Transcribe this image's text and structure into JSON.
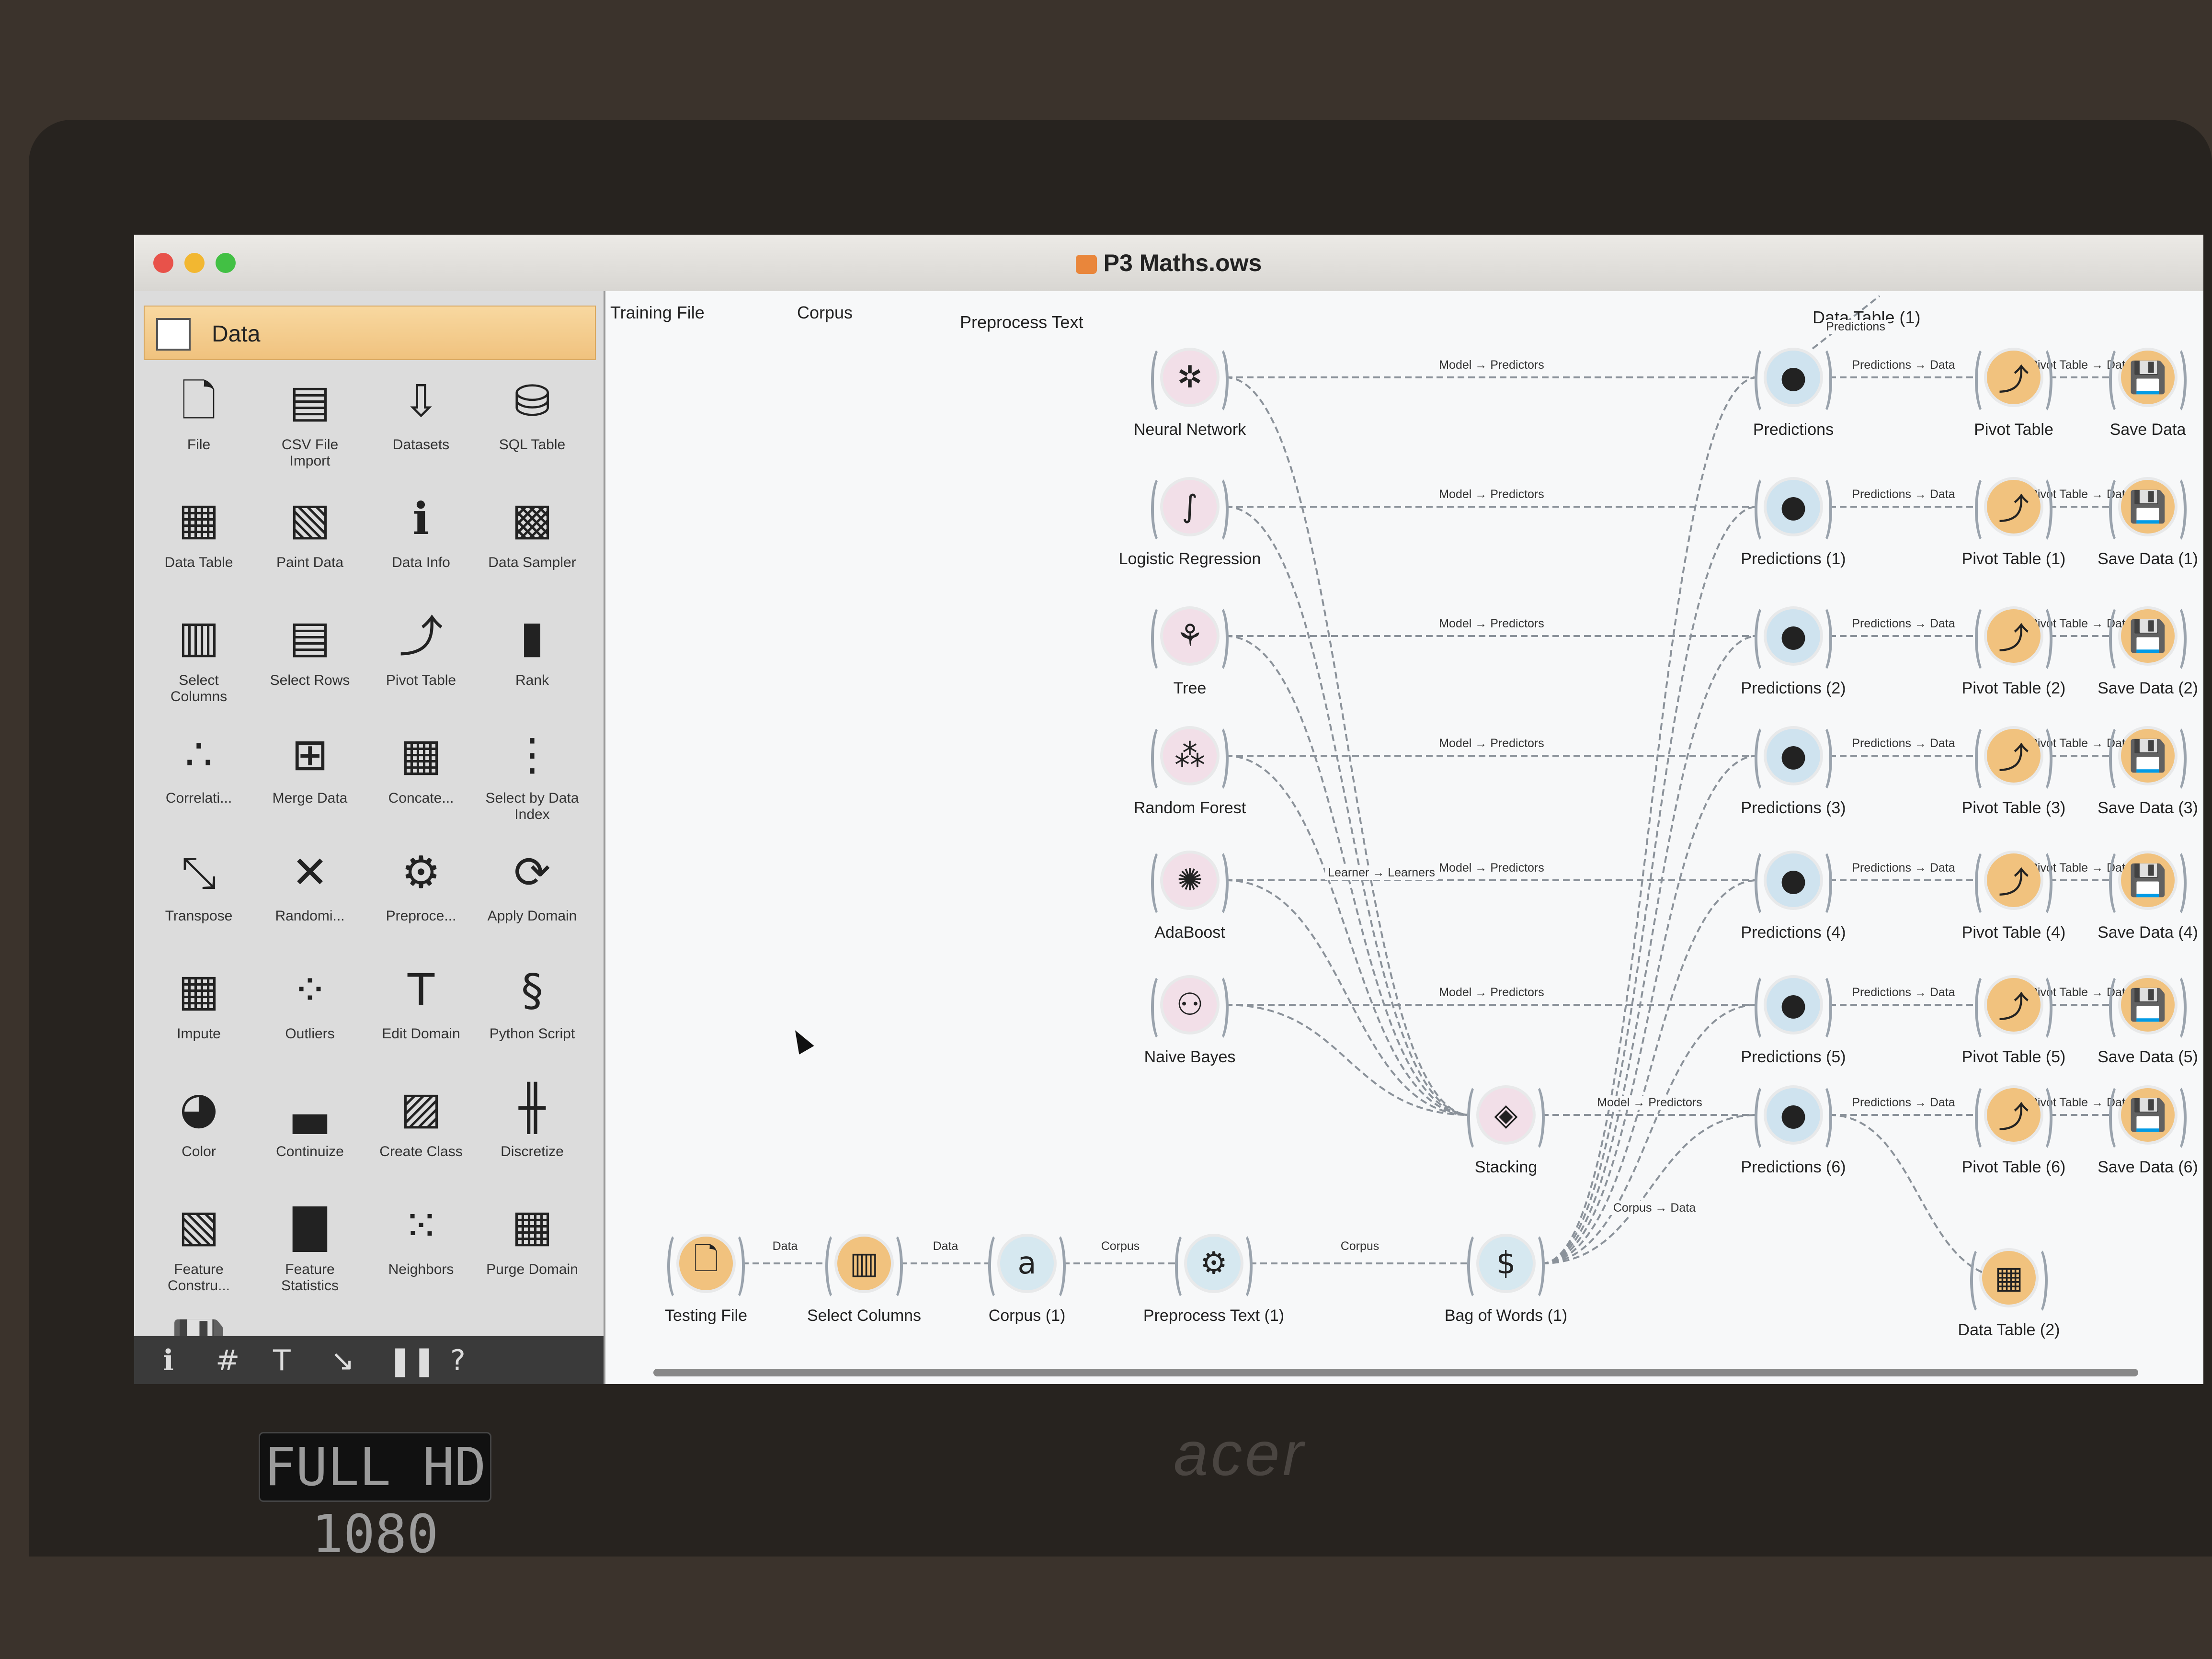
{
  "window": {
    "title": "P3 Maths.ows"
  },
  "device": {
    "hd_badge": "FULL HD 1080",
    "brand": "acer"
  },
  "colors": {
    "data": "#f1c27e",
    "model": "#f2dfe8",
    "evaluate": "#cfe3ef",
    "text": "#d6e8f0",
    "link": "#8b929a"
  },
  "toolbox": {
    "category": "Data",
    "widgets": [
      {
        "label": "File",
        "icon": "file-icon"
      },
      {
        "label": "CSV File Import",
        "icon": "csv-icon"
      },
      {
        "label": "Datasets",
        "icon": "datasets-icon"
      },
      {
        "label": "SQL Table",
        "icon": "database-icon"
      },
      {
        "label": "Data Table",
        "icon": "table-icon"
      },
      {
        "label": "Paint Data",
        "icon": "paint-icon"
      },
      {
        "label": "Data Info",
        "icon": "info-icon"
      },
      {
        "label": "Data Sampler",
        "icon": "sampler-icon"
      },
      {
        "label": "Select Columns",
        "icon": "select-columns-icon"
      },
      {
        "label": "Select Rows",
        "icon": "select-rows-icon"
      },
      {
        "label": "Pivot Table",
        "icon": "pivot-icon"
      },
      {
        "label": "Rank",
        "icon": "rank-icon"
      },
      {
        "label": "Correlati...",
        "icon": "correlation-icon"
      },
      {
        "label": "Merge Data",
        "icon": "merge-icon"
      },
      {
        "label": "Concate...",
        "icon": "concatenate-icon"
      },
      {
        "label": "Select by Data Index",
        "icon": "select-index-icon"
      },
      {
        "label": "Transpose",
        "icon": "transpose-icon"
      },
      {
        "label": "Randomi...",
        "icon": "randomize-icon"
      },
      {
        "label": "Preproce...",
        "icon": "preprocess-icon"
      },
      {
        "label": "Apply Domain",
        "icon": "apply-domain-icon"
      },
      {
        "label": "Impute",
        "icon": "impute-icon"
      },
      {
        "label": "Outliers",
        "icon": "outliers-icon"
      },
      {
        "label": "Edit Domain",
        "icon": "edit-domain-icon"
      },
      {
        "label": "Python Script",
        "icon": "python-icon"
      },
      {
        "label": "Color",
        "icon": "color-icon"
      },
      {
        "label": "Continuize",
        "icon": "continuize-icon"
      },
      {
        "label": "Create Class",
        "icon": "create-class-icon"
      },
      {
        "label": "Discretize",
        "icon": "discretize-icon"
      },
      {
        "label": "Feature Constru...",
        "icon": "feature-constructor-icon"
      },
      {
        "label": "Feature Statistics",
        "icon": "feature-statistics-icon"
      },
      {
        "label": "Neighbors",
        "icon": "neighbors-icon"
      },
      {
        "label": "Purge Domain",
        "icon": "purge-icon"
      },
      {
        "label": "",
        "icon": "save-icon"
      }
    ]
  },
  "canvas": {
    "section_titles": [
      "Training File",
      "Corpus",
      "Preprocess Text",
      "Data Table (1)"
    ],
    "models": [
      "Neural Network",
      "Logistic Regression",
      "Tree",
      "Random Forest",
      "AdaBoost",
      "Naive Bayes"
    ],
    "stacking": "Stacking",
    "pipeline": [
      "Testing File",
      "Select Columns",
      "Corpus (1)",
      "Preprocess Text (1)",
      "Bag of Words (1)"
    ],
    "pipeline_links": [
      "Data",
      "Data",
      "Corpus",
      "Corpus"
    ],
    "predictions": [
      "Predictions",
      "Predictions (1)",
      "Predictions (2)",
      "Predictions (3)",
      "Predictions (4)",
      "Predictions (5)",
      "Predictions (6)"
    ],
    "pivots": [
      "Pivot Table",
      "Pivot Table (1)",
      "Pivot Table (2)",
      "Pivot Table (3)",
      "Pivot Table (4)",
      "Pivot Table (5)",
      "Pivot Table (6)"
    ],
    "saves": [
      "Save Data",
      "Save Data (1)",
      "Save Data (2)",
      "Save Data (3)",
      "Save Data (4)",
      "Save Data (5)",
      "Save Data (6)"
    ],
    "data_table_2": "Data Table (2)",
    "link_model_predictors": "Model → Predictors",
    "link_predictions_data": "Predictions → Data",
    "link_pivot_data": "Pivot Table → Data",
    "link_learner": "Learner → Learners",
    "link_corpus_data": "Corpus → Data",
    "link_predictions_top": "Predictions"
  }
}
